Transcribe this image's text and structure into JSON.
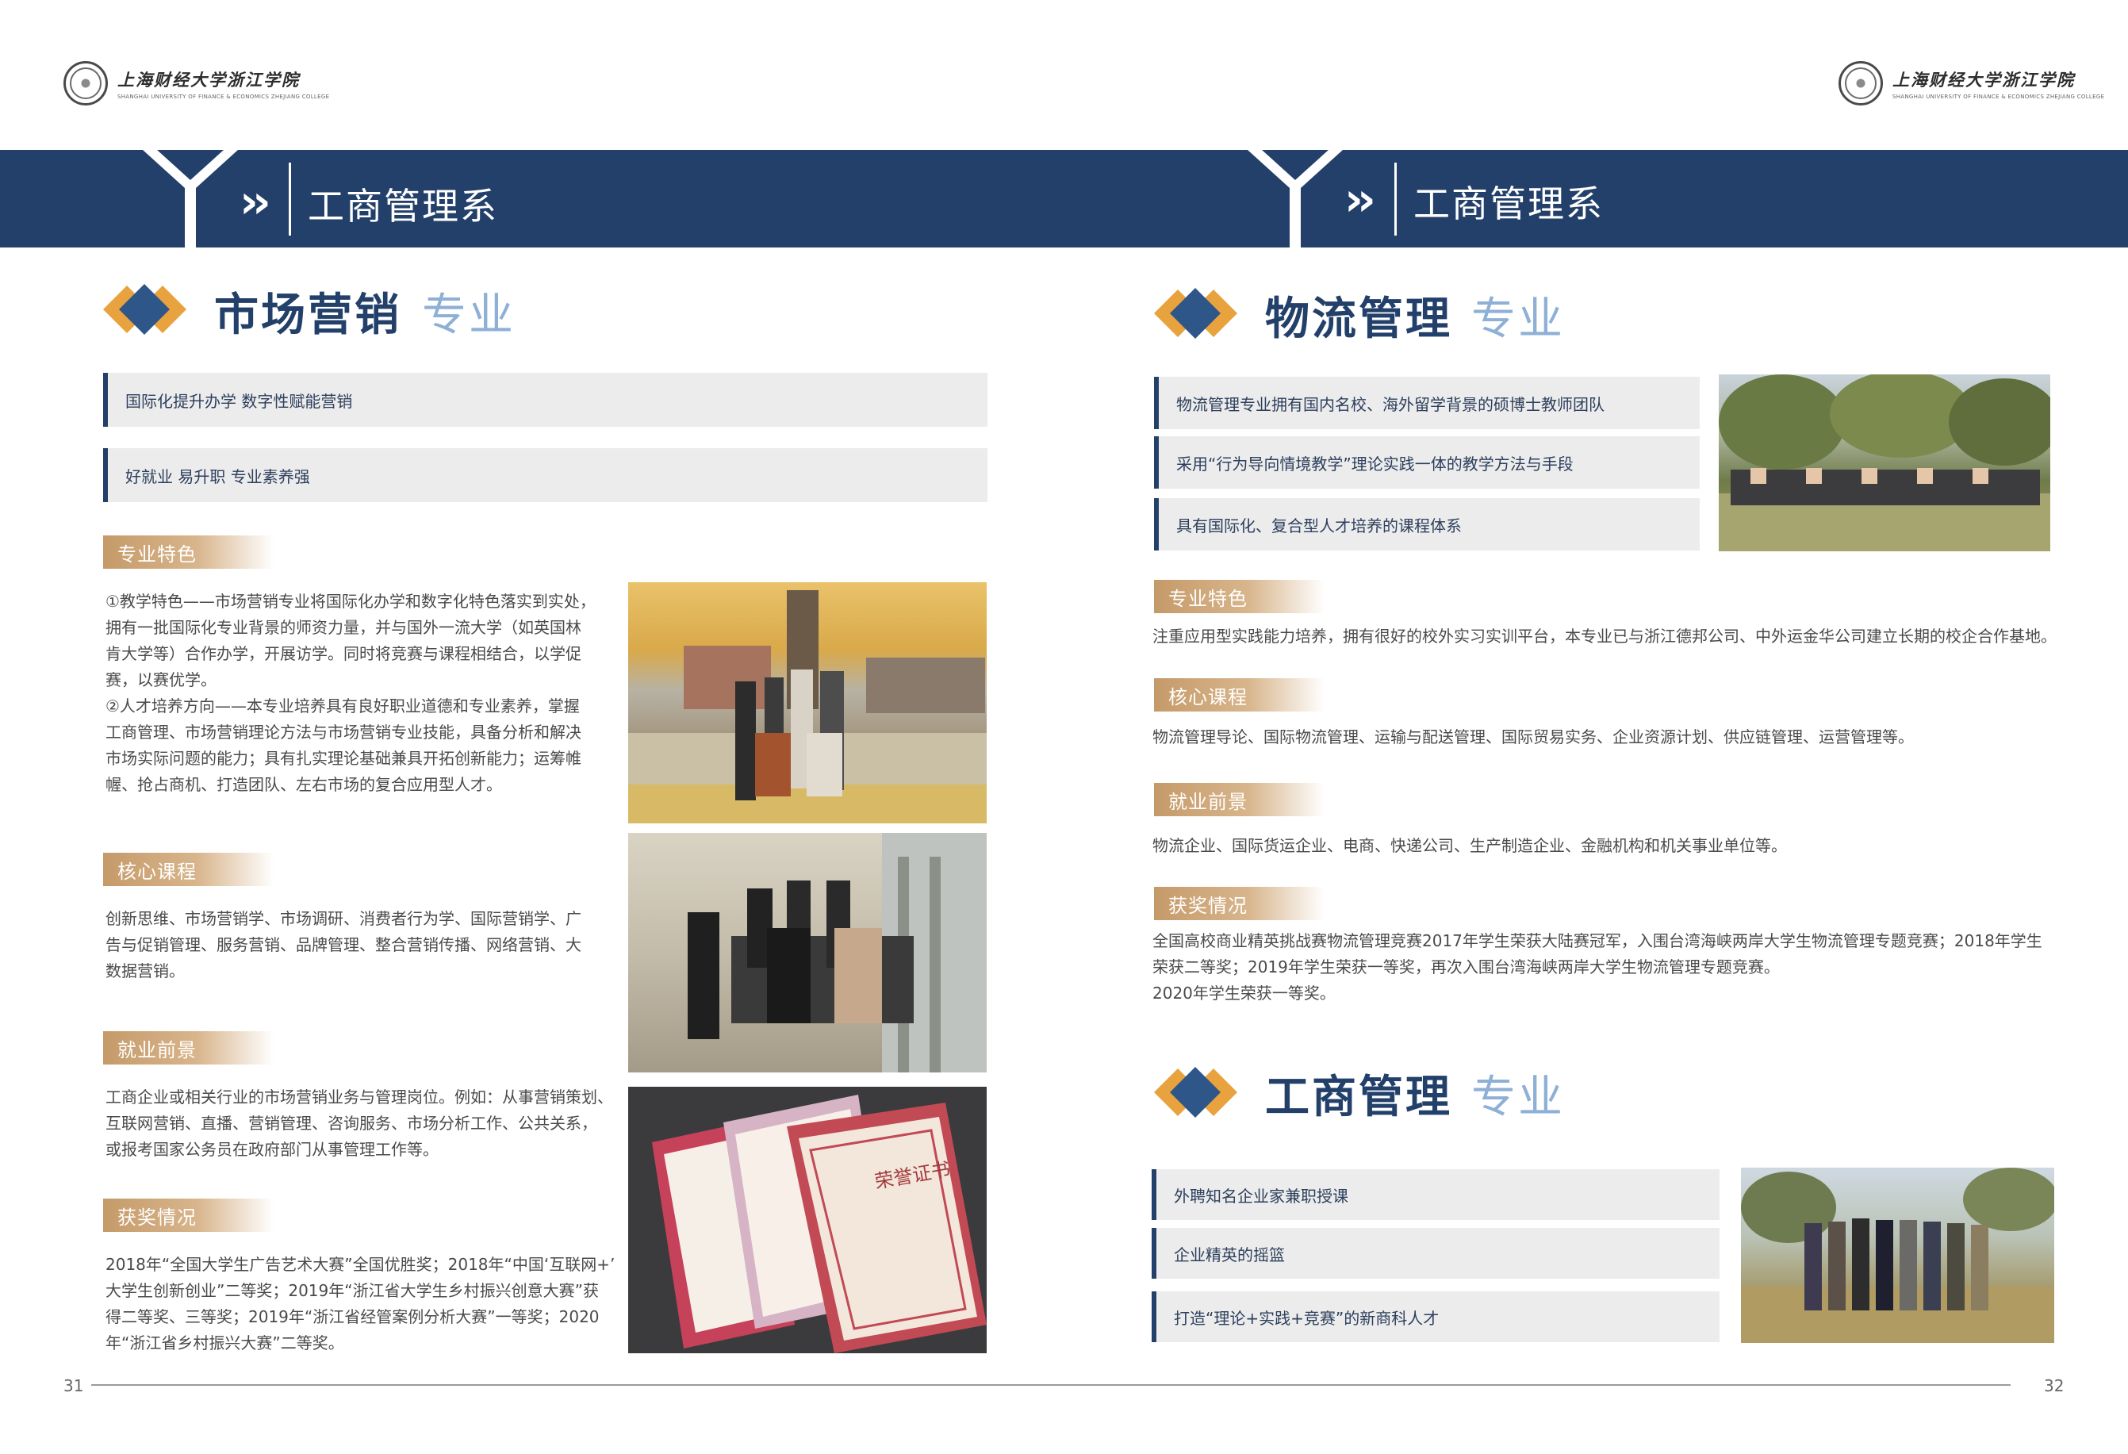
{
  "header": {
    "logo_cn": "上海财经大学浙江学院",
    "logo_en": "SHANGHAI UNIVERSITY OF FINANCE & ECONOMICS ZHEJIANG COLLEGE"
  },
  "banner": {
    "left_title": "工商管理系",
    "right_title": "工商管理系"
  },
  "left_page": {
    "section_title": "市场营销",
    "section_suffix": "专业",
    "features": [
      "国际化提升办学 数字性赋能营销",
      "好就业 易升职 专业素养强"
    ],
    "blocks": [
      {
        "tag": "专业特色",
        "text": "①教学特色——市场营销专业将国际化办学和数字化特色落实到实处，\n拥有一批国际化专业背景的师资力量，并与国外一流大学（如英国林\n肯大学等）合作办学，开展访学。同时将竞赛与课程相结合，以学促\n赛，以赛优学。\n②人才培养方向——本专业培养具有良好职业道德和专业素养，掌握\n工商管理、市场营销理论方法与市场营销专业技能，具备分析和解决\n市场实际问题的能力；具有扎实理论基础兼具开拓创新能力；运筹帷\n幄、抢占商机、打造团队、左右市场的复合应用型人才。"
      },
      {
        "tag": "核心课程",
        "text": "创新思维、市场营销学、市场调研、消费者行为学、国际营销学、广\n告与促销管理、服务营销、品牌管理、整合营销传播、网络营销、大\n数据营销。"
      },
      {
        "tag": "就业前景",
        "text": "工商企业或相关行业的市场营销业务与管理岗位。例如：从事营销策划、\n互联网营销、直播、营销管理、咨询服务、市场分析工作、公共关系，\n或报考国家公务员在政府部门从事管理工作等。"
      },
      {
        "tag": "获奖情况",
        "text": "2018年“全国大学生广告艺术大赛”全国优胜奖；2018年“中国‘互联网+’\n大学生创新创业”二等奖；2019年“浙江省大学生乡村振兴创意大赛”获\n得二等奖、三等奖；2019年“浙江省经管案例分析大赛”一等奖；2020\n年“浙江省乡村振兴大赛”二等奖。"
      }
    ],
    "certificate_text": "荣誉证书",
    "page_number": "31"
  },
  "right_page": {
    "section_title": "物流管理",
    "section_suffix": "专业",
    "features": [
      "物流管理专业拥有国内名校、海外留学背景的硕博士教师团队",
      "采用“行为导向情境教学”理论实践一体的教学方法与手段",
      "具有国际化、复合型人才培养的课程体系"
    ],
    "blocks": [
      {
        "tag": "专业特色",
        "text": "注重应用型实践能力培养，拥有很好的校外实习实训平台，本专业已与浙江德邦公司、中外运金华公司建立长期的校企合作基地。"
      },
      {
        "tag": "核心课程",
        "text": "物流管理导论、国际物流管理、运输与配送管理、国际贸易实务、企业资源计划、供应链管理、运营管理等。"
      },
      {
        "tag": "就业前景",
        "text": "物流企业、国际货运企业、电商、快递公司、生产制造企业、金融机构和机关事业单位等。"
      },
      {
        "tag": "获奖情况",
        "text": "全国高校商业精英挑战赛物流管理竞赛2017年学生荣获大陆赛冠军，入围台湾海峡两岸大学生物流管理专题竞赛；2018年学生\n荣获二等奖；2019年学生荣获一等奖，再次入围台湾海峡两岸大学生物流管理专题竞赛。\n2020年学生荣获一等奖。"
      }
    ],
    "section2_title": "工商管理",
    "section2_suffix": "专业",
    "features2": [
      "外聘知名企业家兼职授课",
      "企业精英的摇篮",
      "打造“理论+实践+竞赛”的新商科人才"
    ],
    "page_number": "32"
  },
  "colors": {
    "navy": "#23406a",
    "gold": "#c59a69",
    "orange": "#e8a23e",
    "light_blue": "#8fb0d6",
    "grey_bar": "#ececec"
  }
}
